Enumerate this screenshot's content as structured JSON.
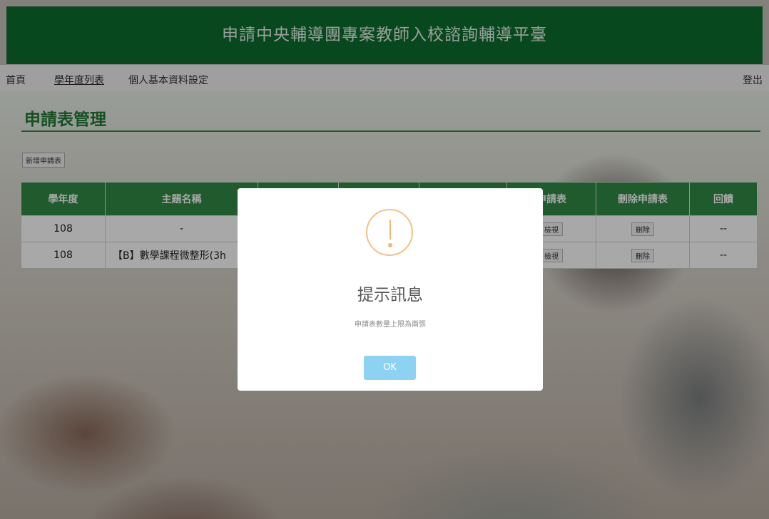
{
  "header": {
    "title": "申請中央輔導團專案教師入校諮詢輔導平臺"
  },
  "nav": {
    "home": "首頁",
    "year_list": "學年度列表",
    "profile": "個人基本資料設定",
    "logout": "登出"
  },
  "page": {
    "title": "申請表管理",
    "add_button": "新增申請表"
  },
  "table": {
    "headers": [
      "學年度",
      "主題名稱",
      "",
      "",
      "",
      "申請表",
      "刪除申請表",
      "回饋"
    ],
    "rows": [
      {
        "year": "108",
        "topic": "-",
        "view": "檢視",
        "delete": "刪除",
        "feedback": "--"
      },
      {
        "year": "108",
        "topic": "【B】數學課程微整形(3h",
        "view": "檢視",
        "delete": "刪除",
        "feedback": "--"
      }
    ]
  },
  "modal": {
    "icon": "warning-icon",
    "title": "提示訊息",
    "message": "申請表數量上限為兩張",
    "ok_label": "OK"
  },
  "colors": {
    "header_green": "#0d6e2f",
    "table_header_green": "#2f8a44",
    "ok_button": "#8ed2f3",
    "warning": "#f4c08a"
  }
}
